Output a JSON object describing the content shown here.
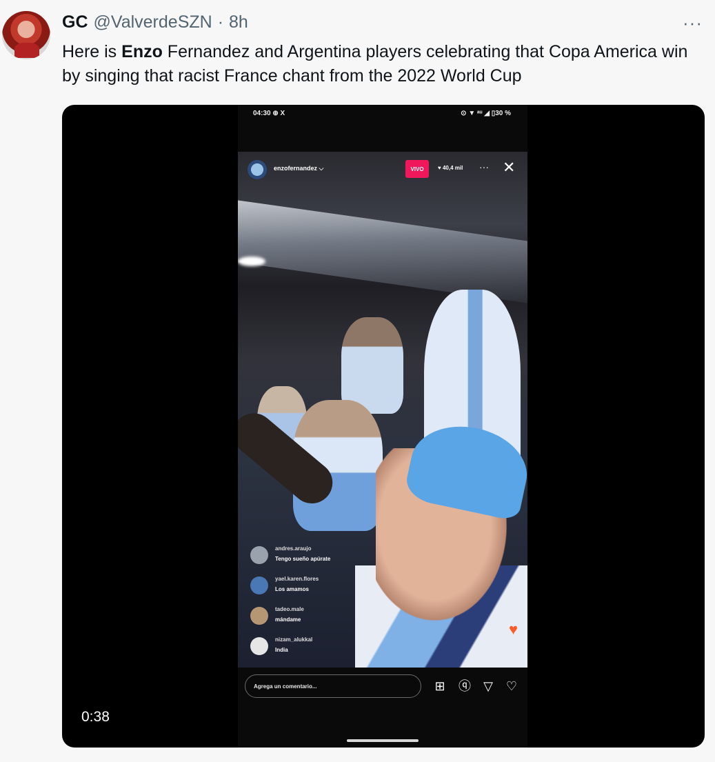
{
  "tweet": {
    "author_name": "GC",
    "handle": "@ValverdeSZN",
    "separator": "·",
    "time": "8h",
    "more_label": "···",
    "text_before": "Here is ",
    "text_bold": "Enzo",
    "text_after": " Fernandez and Argentina players celebrating that Copa America win by singing that racist France chant from the 2022 World Cup"
  },
  "video": {
    "duration": "0:38"
  },
  "phone": {
    "status_left": "04:30 ⊕ X",
    "status_right": "⊙ ▼ ᵃᵘ ◢ ▯30 %",
    "live_username": "enzofernandez ⌵",
    "live_badge": "VIVO",
    "viewer_count": "♥ 40,4 mil",
    "more_glyph": "···",
    "close_glyph": "✕",
    "comments": [
      {
        "user": "andres.araujo",
        "message": "Tengo sueño apúrate"
      },
      {
        "user": "yael.karen.flores",
        "message": "Los amamos"
      },
      {
        "user": "tadeo.male",
        "message": "mándame"
      },
      {
        "user": "nizam_alukkal",
        "message": "India"
      }
    ],
    "comment_placeholder": "Agrega un comentario...",
    "icons": [
      "add-guest-icon",
      "question-icon",
      "send-icon",
      "heart-icon"
    ]
  }
}
